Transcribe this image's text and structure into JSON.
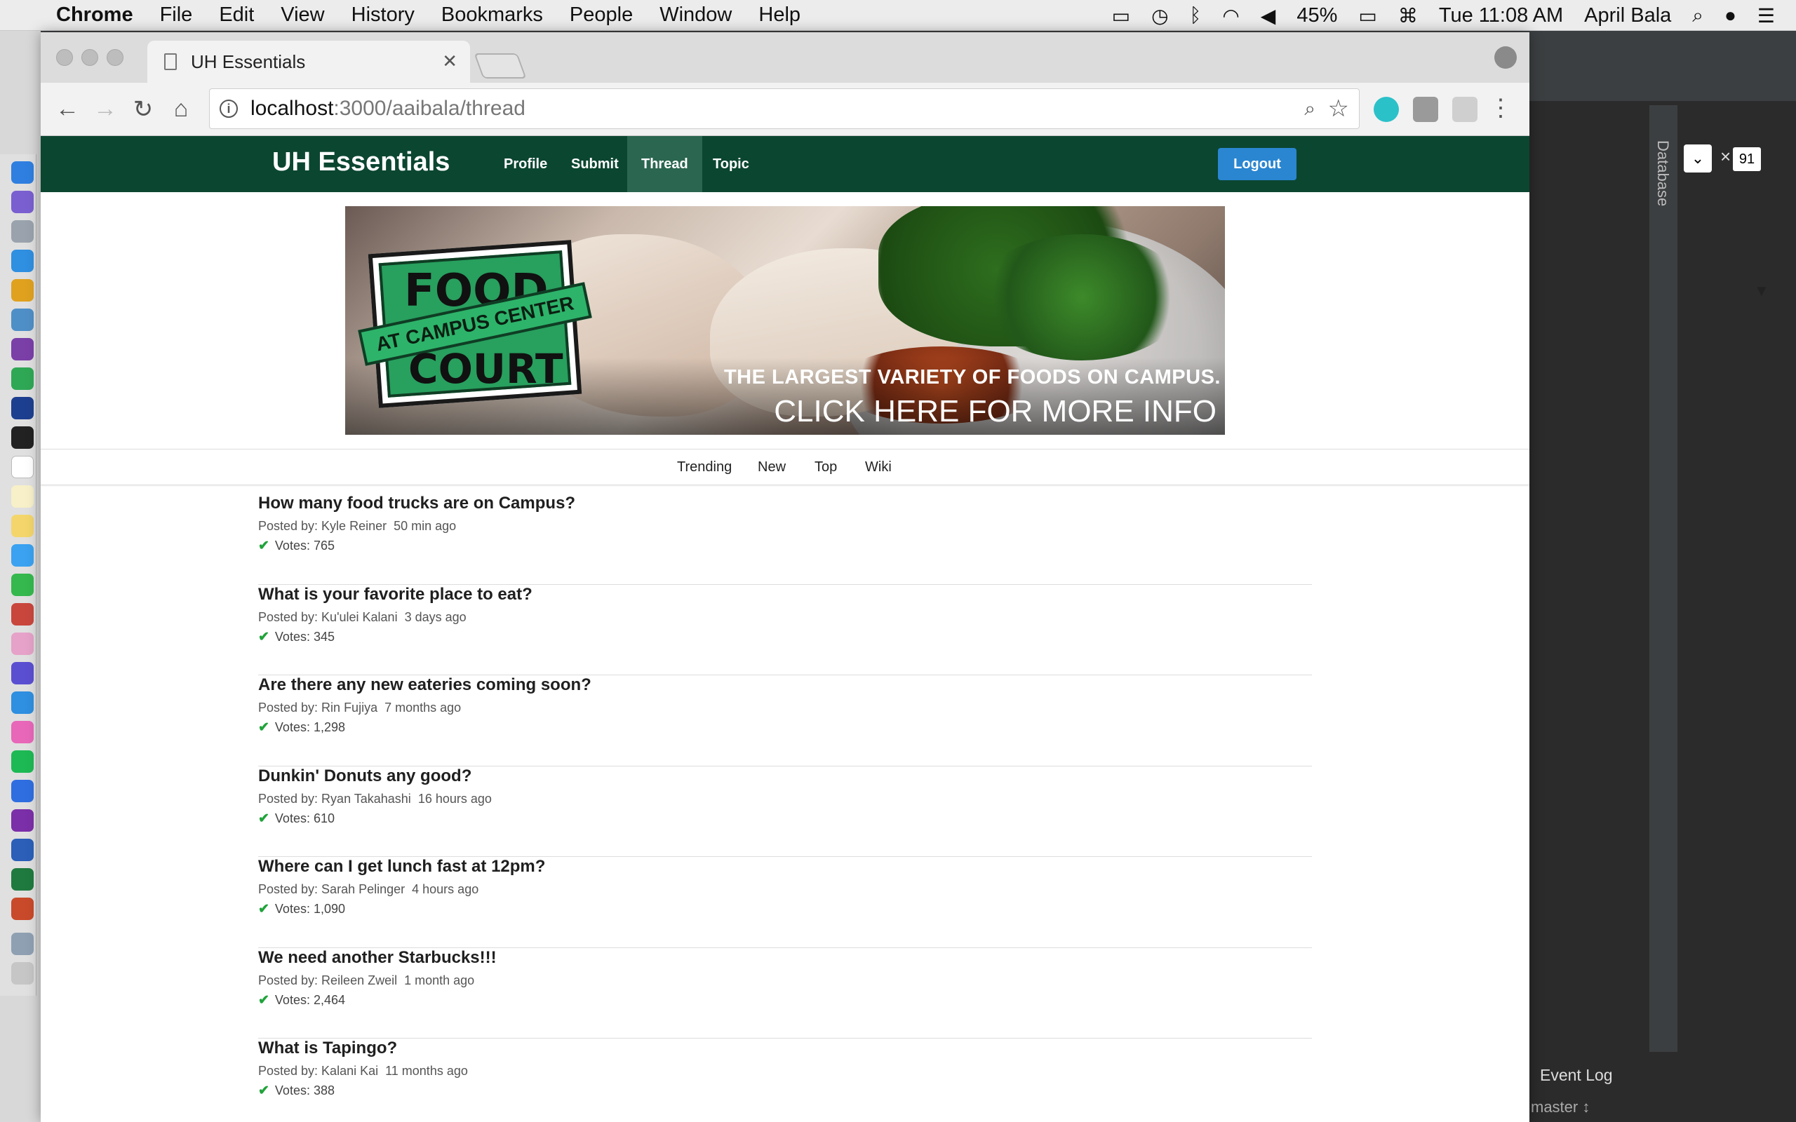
{
  "menubar": {
    "app": "Chrome",
    "items": [
      "File",
      "Edit",
      "View",
      "History",
      "Bookmarks",
      "People",
      "Window",
      "Help"
    ],
    "battery": "45%",
    "clock": "Tue 11:08 AM",
    "user": "April Bala"
  },
  "browser": {
    "tab_title": "UH Essentials",
    "url_host": "localhost",
    "url_path": ":3000/aaibala/thread"
  },
  "navbar": {
    "brand": "UH Essentials",
    "links": [
      "Profile",
      "Submit",
      "Thread",
      "Topic"
    ],
    "active": "Thread",
    "logout": "Logout",
    "color": "#0b4631"
  },
  "banner": {
    "logo_word1": "FOOD",
    "logo_word2": "COURT",
    "logo_ribbon": "AT CAMPUS CENTER",
    "tagline": "THE LARGEST VARIETY OF FOODS ON CAMPUS.",
    "cta": "CLICK HERE FOR MORE INFO"
  },
  "subnav": [
    "Trending",
    "New",
    "Top",
    "Wiki"
  ],
  "threads": [
    {
      "title": "How many food trucks are on Campus?",
      "author": "Posted by: Kyle Reiner",
      "time": "50 min ago",
      "votes": "Votes: 765"
    },
    {
      "title": "What is your favorite place to eat?",
      "author": "Posted by: Ku'ulei Kalani",
      "time": "3 days ago",
      "votes": "Votes: 345"
    },
    {
      "title": "Are there any new eateries coming soon?",
      "author": "Posted by: Rin Fujiya",
      "time": "7 months ago",
      "votes": "Votes: 1,298"
    },
    {
      "title": "Dunkin' Donuts any good?",
      "author": "Posted by: Ryan Takahashi",
      "time": "16 hours ago",
      "votes": "Votes: 610"
    },
    {
      "title": "Where can I get lunch fast at 12pm?",
      "author": "Posted by: Sarah Pelinger",
      "time": "4 hours ago",
      "votes": "Votes: 1,090"
    },
    {
      "title": "We need another Starbucks!!!",
      "author": "Posted by: Reileen Zweil",
      "time": "1 month ago",
      "votes": "Votes: 2,464"
    },
    {
      "title": "What is Tapingo?",
      "author": "Posted by: Kalani Kai",
      "time": "11 months ago",
      "votes": "Votes: 388"
    }
  ],
  "ide": {
    "sidebar_label": "Database",
    "event_log": "Event Log",
    "branch": "master ↕",
    "field_text": "91"
  }
}
